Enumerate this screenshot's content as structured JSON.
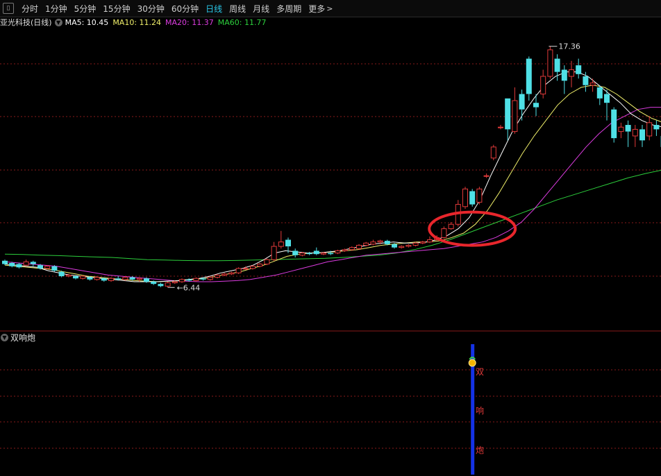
{
  "toolbar": {
    "periods": [
      "分时",
      "1分钟",
      "5分钟",
      "15分钟",
      "30分钟",
      "60分钟",
      "日线",
      "周线",
      "月线",
      "多周期",
      "更多"
    ],
    "active_period": "日线",
    "more_arrow": ">"
  },
  "legend": {
    "stock": "亚光科技(日线)",
    "ma5": "MA5: 10.45",
    "ma10": "MA10: 11.24",
    "ma20": "MA20: 11.37",
    "ma60": "MA60: 11.77"
  },
  "colors": {
    "up": "#e23a3a",
    "down": "#4fe0e6",
    "ma5": "#ffffff",
    "ma10": "#f0ef6a",
    "ma20": "#dc3ce0",
    "ma60": "#2ccf3c",
    "grid": "#8a1a1a",
    "signal_bar": "#1432e6",
    "highlight": "#e8262c"
  },
  "annotations": {
    "high_label": "17.36",
    "low_label": "6.44"
  },
  "sub_panel": {
    "title": "双响炮",
    "signal_chars": [
      "双",
      "响",
      "炮"
    ]
  },
  "chart_data": {
    "type": "candlestick",
    "price_range": [
      4.5,
      18.2
    ],
    "high": 17.36,
    "low": 6.44,
    "candles": [
      [
        0,
        7.65,
        7.5,
        7.7,
        7.45
      ],
      [
        1,
        7.55,
        7.4,
        7.6,
        7.35
      ],
      [
        2,
        7.5,
        7.35,
        7.55,
        7.3
      ],
      [
        3,
        7.45,
        7.6,
        7.7,
        7.4
      ],
      [
        4,
        7.6,
        7.5,
        7.65,
        7.4
      ],
      [
        5,
        7.45,
        7.3,
        7.5,
        7.25
      ],
      [
        6,
        7.3,
        7.4,
        7.45,
        7.25
      ],
      [
        7,
        7.4,
        7.2,
        7.45,
        7.15
      ],
      [
        8,
        7.15,
        6.95,
        7.2,
        6.9
      ],
      [
        9,
        6.95,
        7.0,
        7.05,
        6.9
      ],
      [
        10,
        6.95,
        6.85,
        7.0,
        6.8
      ],
      [
        11,
        6.85,
        6.95,
        7.0,
        6.8
      ],
      [
        12,
        6.9,
        6.8,
        6.95,
        6.75
      ],
      [
        13,
        6.8,
        6.9,
        6.95,
        6.75
      ],
      [
        14,
        6.85,
        6.75,
        6.9,
        6.7
      ],
      [
        15,
        6.75,
        6.85,
        6.9,
        6.7
      ],
      [
        16,
        6.85,
        6.8,
        6.95,
        6.75
      ],
      [
        17,
        6.8,
        6.9,
        6.95,
        6.75
      ],
      [
        18,
        6.9,
        6.8,
        6.95,
        6.75
      ],
      [
        19,
        6.8,
        6.85,
        6.9,
        6.7
      ],
      [
        20,
        6.85,
        6.7,
        6.9,
        6.65
      ],
      [
        21,
        6.7,
        6.6,
        6.75,
        6.55
      ],
      [
        22,
        6.6,
        6.5,
        6.65,
        6.45
      ],
      [
        23,
        6.5,
        6.65,
        6.7,
        6.44
      ],
      [
        24,
        6.65,
        6.7,
        6.75,
        6.6
      ],
      [
        25,
        6.7,
        6.8,
        6.85,
        6.65
      ],
      [
        26,
        6.8,
        6.75,
        6.85,
        6.7
      ],
      [
        27,
        6.75,
        6.85,
        6.9,
        6.7
      ],
      [
        28,
        6.85,
        6.8,
        6.9,
        6.75
      ],
      [
        29,
        6.8,
        6.9,
        6.95,
        6.75
      ],
      [
        30,
        6.9,
        7.0,
        7.05,
        6.85
      ],
      [
        31,
        7.0,
        7.05,
        7.1,
        6.95
      ],
      [
        32,
        7.05,
        7.1,
        7.15,
        7.0
      ],
      [
        33,
        7.1,
        7.3,
        7.35,
        7.05
      ],
      [
        34,
        7.3,
        7.3,
        7.4,
        7.25
      ],
      [
        35,
        7.3,
        7.4,
        7.45,
        7.25
      ],
      [
        36,
        7.4,
        7.5,
        7.55,
        7.35
      ],
      [
        37,
        7.5,
        7.7,
        7.75,
        7.45
      ],
      [
        38,
        7.7,
        8.3,
        8.5,
        7.65
      ],
      [
        39,
        8.3,
        8.5,
        9.0,
        8.2
      ],
      [
        40,
        8.6,
        8.3,
        8.7,
        8.0
      ],
      [
        41,
        8.1,
        7.9,
        8.2,
        7.8
      ],
      [
        42,
        7.9,
        8.0,
        8.05,
        7.85
      ],
      [
        43,
        8.0,
        7.95,
        8.05,
        7.9
      ],
      [
        44,
        8.1,
        7.95,
        8.25,
        7.9
      ],
      [
        45,
        7.95,
        8.0,
        8.05,
        7.9
      ],
      [
        46,
        8.0,
        7.95,
        8.1,
        7.9
      ],
      [
        47,
        8.0,
        8.1,
        8.15,
        7.95
      ],
      [
        48,
        8.1,
        8.15,
        8.2,
        8.05
      ],
      [
        49,
        8.15,
        8.25,
        8.3,
        8.1
      ],
      [
        50,
        8.2,
        8.35,
        8.4,
        8.15
      ],
      [
        51,
        8.35,
        8.45,
        8.5,
        8.3
      ],
      [
        52,
        8.4,
        8.5,
        8.6,
        8.35
      ],
      [
        53,
        8.5,
        8.55,
        8.6,
        8.4
      ],
      [
        54,
        8.55,
        8.4,
        8.6,
        8.35
      ],
      [
        55,
        8.4,
        8.25,
        8.45,
        8.2
      ],
      [
        56,
        8.25,
        8.3,
        8.35,
        8.2
      ],
      [
        57,
        8.3,
        8.35,
        8.4,
        8.25
      ],
      [
        58,
        8.35,
        8.45,
        8.5,
        8.3
      ],
      [
        59,
        8.45,
        8.5,
        8.55,
        8.4
      ],
      [
        60,
        8.5,
        8.6,
        8.75,
        8.45
      ],
      [
        61,
        8.6,
        8.7,
        8.8,
        8.55
      ],
      [
        62,
        8.7,
        9.1,
        9.2,
        8.65
      ],
      [
        63,
        9.1,
        9.3,
        9.4,
        9.05
      ],
      [
        64,
        9.3,
        10.2,
        10.4,
        9.2
      ],
      [
        65,
        10.1,
        10.9,
        11.0,
        10.0
      ],
      [
        66,
        10.8,
        10.2,
        10.9,
        10.1
      ],
      [
        67,
        10.3,
        10.9,
        11.0,
        10.2
      ],
      [
        68,
        11.5,
        11.5,
        11.6,
        11.4
      ],
      [
        69,
        12.3,
        12.8,
        12.9,
        12.2
      ],
      [
        70,
        13.7,
        13.7,
        13.8,
        13.6
      ],
      [
        71,
        15.0,
        13.6,
        15.0,
        13.1
      ],
      [
        72,
        13.5,
        14.9,
        15.5,
        13.4
      ],
      [
        73,
        15.2,
        14.5,
        15.4,
        14.0
      ],
      [
        74,
        16.8,
        15.2,
        16.9,
        14.9
      ],
      [
        75,
        14.8,
        14.6,
        15.2,
        14.2
      ],
      [
        76,
        15.2,
        16.0,
        16.3,
        15.0
      ],
      [
        77,
        16.0,
        17.2,
        17.36,
        15.9
      ],
      [
        78,
        16.8,
        16.2,
        17.0,
        15.8
      ],
      [
        79,
        16.3,
        15.8,
        16.5,
        15.2
      ],
      [
        80,
        16.0,
        16.3,
        16.7,
        15.5
      ],
      [
        81,
        16.5,
        16.1,
        16.8,
        15.9
      ],
      [
        82,
        16.0,
        15.6,
        16.2,
        15.3
      ],
      [
        83,
        15.6,
        15.7,
        15.9,
        15.3
      ],
      [
        84,
        15.5,
        15.0,
        15.6,
        14.7
      ],
      [
        85,
        15.2,
        14.8,
        15.4,
        14.0
      ],
      [
        86,
        14.5,
        13.2,
        14.6,
        13.0
      ],
      [
        87,
        13.5,
        13.7,
        13.9,
        13.2
      ],
      [
        88,
        13.8,
        13.5,
        14.0,
        12.8
      ],
      [
        89,
        13.3,
        13.6,
        13.8,
        12.8
      ],
      [
        90,
        13.6,
        13.1,
        13.8,
        12.8
      ],
      [
        91,
        13.3,
        13.9,
        14.2,
        13.1
      ],
      [
        92,
        13.8,
        13.6,
        14.0,
        13.3
      ],
      [
        93,
        13.3,
        12.8,
        13.5,
        12.6
      ]
    ],
    "ma": {
      "MA5": [
        7.5,
        7.45,
        7.4,
        7.35,
        7.2,
        7.1,
        7.0,
        6.95,
        6.9,
        6.85,
        6.8,
        6.75,
        6.7,
        6.7,
        6.7,
        6.72,
        6.75,
        6.8,
        6.85,
        6.95,
        7.1,
        7.2,
        7.3,
        7.45,
        7.7,
        8.0,
        8.1,
        8.05,
        8.0,
        8.0,
        8.05,
        8.1,
        8.2,
        8.3,
        8.4,
        8.45,
        8.5,
        8.45,
        8.45,
        8.5,
        8.6,
        8.8,
        9.1,
        9.6,
        10.4,
        11.5,
        12.5,
        13.5,
        14.3,
        15.0,
        15.6,
        16.0,
        16.2,
        16.2,
        16.0,
        15.6,
        15.2,
        14.8,
        14.3,
        14.0,
        13.8,
        13.7
      ],
      "MA10": [
        7.45,
        7.4,
        7.35,
        7.3,
        7.25,
        7.15,
        7.05,
        6.95,
        6.9,
        6.85,
        6.8,
        6.75,
        6.72,
        6.7,
        6.72,
        6.75,
        6.8,
        6.85,
        6.95,
        7.05,
        7.15,
        7.3,
        7.45,
        7.65,
        7.85,
        7.95,
        8.0,
        8.02,
        8.05,
        8.1,
        8.15,
        8.25,
        8.35,
        8.4,
        8.45,
        8.5,
        8.5,
        8.55,
        8.7,
        8.9,
        9.3,
        9.9,
        10.7,
        11.6,
        12.5,
        13.3,
        14.0,
        14.7,
        15.2,
        15.5,
        15.6,
        15.5,
        15.2,
        14.8,
        14.4,
        14.1,
        13.9
      ],
      "MA20": [
        7.6,
        7.55,
        7.5,
        7.45,
        7.4,
        7.3,
        7.2,
        7.1,
        7.0,
        6.95,
        6.9,
        6.85,
        6.8,
        6.75,
        6.72,
        6.7,
        6.7,
        6.72,
        6.75,
        6.8,
        6.9,
        7.0,
        7.15,
        7.3,
        7.45,
        7.6,
        7.7,
        7.8,
        7.9,
        7.95,
        8.0,
        8.05,
        8.1,
        8.15,
        8.2,
        8.3,
        8.4,
        8.5,
        8.7,
        9.0,
        9.4,
        10.0,
        10.7,
        11.4,
        12.1,
        12.8,
        13.4,
        13.9,
        14.2,
        14.5,
        14.6,
        14.6
      ],
      "MA60": [
        7.95,
        7.93,
        7.9,
        7.88,
        7.85,
        7.82,
        7.8,
        7.75,
        7.7,
        7.68,
        7.66,
        7.65,
        7.65,
        7.66,
        7.68,
        7.7,
        7.72,
        7.74,
        7.76,
        7.8,
        7.85,
        7.9,
        8.0,
        8.15,
        8.35,
        8.6,
        8.9,
        9.2,
        9.5,
        9.8,
        10.1,
        10.4,
        10.65,
        10.9,
        11.15,
        11.4,
        11.6,
        11.77
      ]
    },
    "signal": {
      "type": "双响炮",
      "candle_index": 65
    }
  }
}
